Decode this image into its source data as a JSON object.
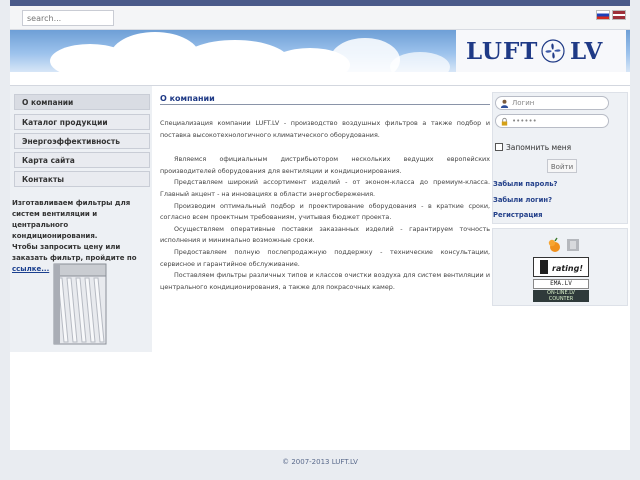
{
  "header": {
    "search_placeholder": "search...",
    "languages": [
      "ru",
      "lv"
    ],
    "logo_left": "LUFT",
    "logo_right": "LV"
  },
  "menu": {
    "items": [
      {
        "label": "О компании",
        "active": true
      },
      {
        "label": "Каталог продукции",
        "active": false
      },
      {
        "label": "Энергоэффективность",
        "active": false
      },
      {
        "label": "Карта сайта",
        "active": false
      },
      {
        "label": "Контакты",
        "active": false
      }
    ]
  },
  "promo": {
    "text_1": "Изготавливаем фильтры для систем вентиляции и центрального кондиционирования.",
    "text_2": "Чтобы запросить цену или заказать фильтр, пройдите по ",
    "link": "ссылке..."
  },
  "content": {
    "title": "О компании",
    "paragraphs": [
      "Специализация компании LUFT.LV - производство воздушных фильтров а также подбор и поставка высокотехнологичного климатического оборудования.",
      "Являемся официальным дистрибьютором нескольких ведущих европейских производителей оборудования для вентиляции и кондиционирования.",
      "Представляем широкий ассортимент изделий - от эконом-класса до премиум-класса. Главный акцент - на инновациях в области энергосбережения.",
      "Производим оптимальный подбор и проектирование оборудования - в краткие сроки, согласно всем проектным требованиям, учитывая бюджет проекта.",
      "Осуществляем оперативные поставки заказанных изделий - гарантируем точность исполнения и минимально возможные сроки.",
      "Предоставляем полную послепродажную поддержку - технические консультации, сервисное и гарантийное обслуживание.",
      "Поставляем фильтры различных типов и классов очистки воздуха для систем вентиляции и центрального кондиционирования, а также для покрасочных камер."
    ]
  },
  "login": {
    "username_placeholder": "Логин",
    "password_value": "••••••",
    "remember_label": "Запомнить меня",
    "submit_label": "Войти",
    "links": [
      "Забыли пароль?",
      "Забыли логин?",
      "Регистрация"
    ]
  },
  "badges": {
    "rating_label": "rating!",
    "ema_label": "EMA.LV",
    "online_line1": "ON-LINE.LV",
    "online_line2": "COUNTER"
  },
  "footer": {
    "copyright": "© 2007-2013 LUFT.LV"
  },
  "colors": {
    "accent": "#1f3a86",
    "link": "#23408a",
    "top_strip": "#4a5a8a",
    "background": "#e9ecf1"
  },
  "icons": [
    "user-icon",
    "lock-icon",
    "checkbox-icon",
    "filter-product-image",
    "orange-logo-icon",
    "grey-badge-icon",
    "rating-badge",
    "ema-badge",
    "online-counter-badge"
  ]
}
